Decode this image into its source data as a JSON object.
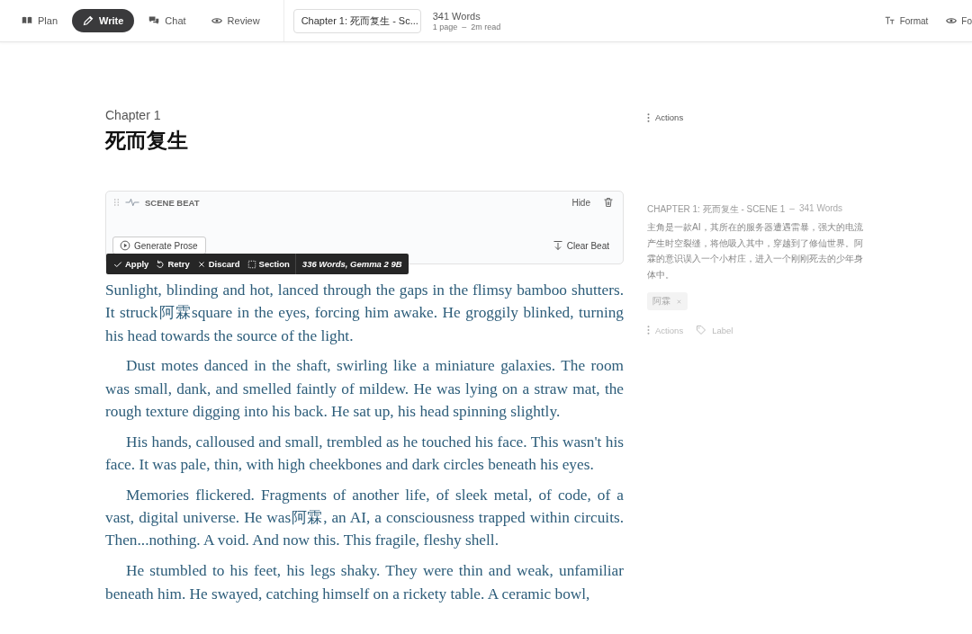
{
  "toolbar": {
    "modes": [
      {
        "label": "Plan",
        "selected": false
      },
      {
        "label": "Write",
        "selected": true
      },
      {
        "label": "Chat",
        "selected": false
      },
      {
        "label": "Review",
        "selected": false
      }
    ],
    "chapter_select": {
      "value": "Chapter 1: 死而复生 - Sc..."
    },
    "stats": {
      "words": "341 Words",
      "pages": "1 page",
      "separator": "–",
      "read": "2m read"
    },
    "right_buttons": [
      {
        "label": "Format"
      },
      {
        "label": "Fo"
      }
    ]
  },
  "chapter": {
    "label": "Chapter 1",
    "title": "死而复生"
  },
  "scene_beat": {
    "title": "SCENE BEAT",
    "hide": "Hide",
    "generate": "Generate Prose",
    "clear": "Clear Beat",
    "actions": [
      {
        "label": "Apply"
      },
      {
        "label": "Retry"
      },
      {
        "label": "Discard"
      },
      {
        "label": "Section"
      }
    ],
    "info": "336 Words, Gemma 2 9B"
  },
  "paragraphs": [
    "Sunlight, blinding and hot, lanced through the gaps in the flimsy bamboo shutters. It struck阿霖square in the eyes, forcing him awake. He groggily blinked, turning his head towards the source of the light.",
    "Dust motes danced in the shaft, swirling like a miniature galaxies. The room was small, dank, and smelled faintly of mildew. He was lying on a straw mat, the rough texture digging into his back. He sat up, his head spinning slightly.",
    "His hands, calloused and small, trembled as he touched his face. This wasn't his face. It was pale, thin, with high cheekbones and dark circles beneath his eyes.",
    "Memories flickered. Fragments of another life, of sleek metal, of code, of a vast, digital universe. He was阿霖, an AI, a consciousness trapped within circuits. Then...nothing. A void. And now this. This fragile, fleshy shell.",
    "He stumbled to his feet, his legs shaky. They were thin and weak, unfamiliar beneath him.  He swayed, catching himself on a rickety table. A ceramic bowl,"
  ],
  "sidebar": {
    "actions_top": "Actions",
    "summary": {
      "heading": "CHAPTER 1: 死而复生 - SCENE 1",
      "separator": "–",
      "words": "341 Words",
      "text": "主角是一款AI，其所在的服务器遭遇雷暴，强大的电流产生时空裂缝，将他吸入其中，穿越到了修仙世界。阿霖的意识误入一个小村庄，进入一个刚刚死去的少年身体中。",
      "tags": [
        "阿霖"
      ]
    },
    "actions_bottom": "Actions",
    "label": "Label"
  }
}
